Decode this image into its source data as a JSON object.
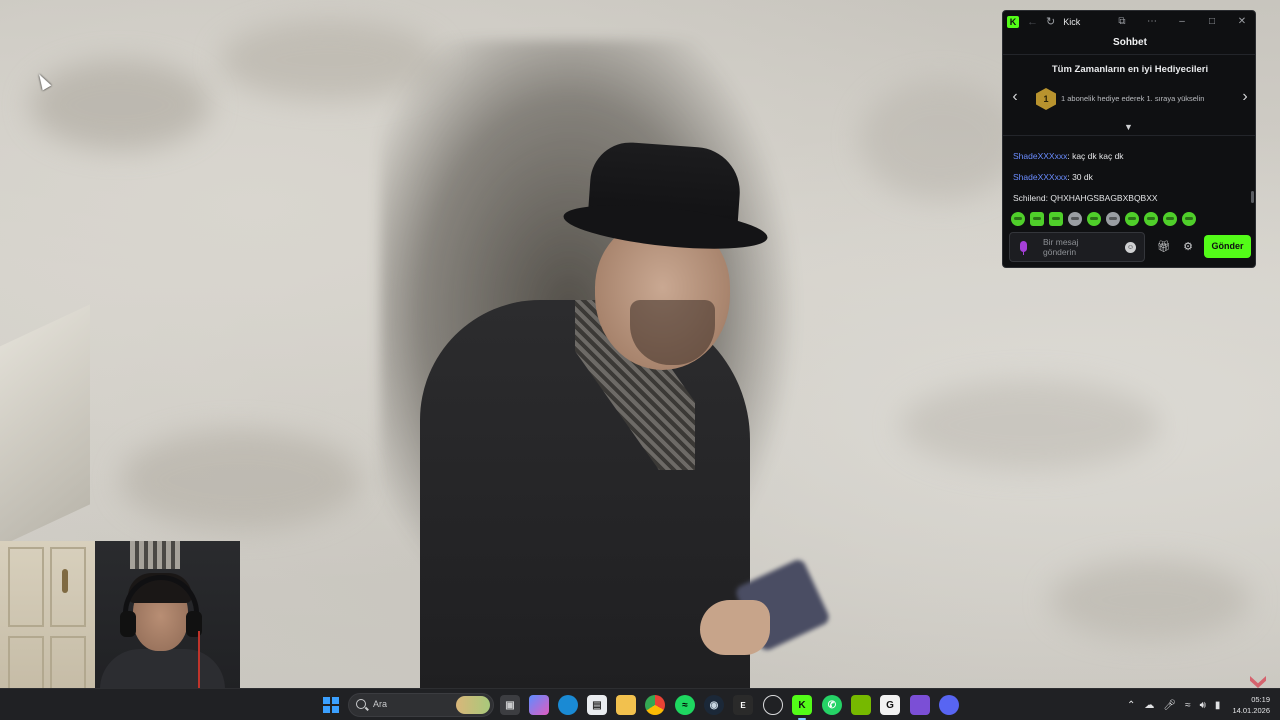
{
  "kick_window": {
    "title": "Kick",
    "chat_header": "Sohbet",
    "gifters": {
      "title": "Tüm Zamanların en iyi Hediyecileri",
      "rank_badge": "1",
      "prompt": "1 abonelik hediye ederek 1. sıraya yükselin"
    },
    "messages": [
      {
        "user": "ShadeXXXxxx",
        "text": ": kaç dk kaç dk"
      },
      {
        "user": "ShadeXXXxxx",
        "text": ": 30 dk"
      },
      {
        "user": "Schilend",
        "text": ": QHXHAHGSBAGBXBQBXX"
      }
    ],
    "input": {
      "placeholder_line1": "Bir mesaj",
      "placeholder_line2": "gönderin"
    },
    "send_label": "Gönder",
    "colors": {
      "accent": "#53fc18",
      "username": "#6a8cff",
      "background": "#0f1012"
    }
  },
  "taskbar": {
    "search_label": "Ara",
    "clock_time": "05:19",
    "clock_date": "14.01.2026",
    "apps": [
      "file-explorer-icon",
      "copilot-icon",
      "edge-icon",
      "store-icon",
      "folder-icon",
      "chrome-icon",
      "spotify-icon",
      "steam-icon",
      "epic-icon",
      "chatgpt-icon",
      "kick-icon",
      "whatsapp-icon",
      "nvidia-icon",
      "g-app-icon",
      "visual-studio-icon",
      "discord-icon"
    ]
  }
}
